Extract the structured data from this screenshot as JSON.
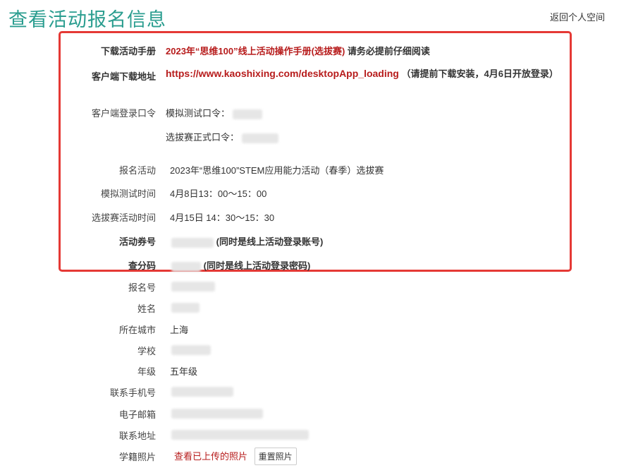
{
  "header": {
    "title": "查看活动报名信息",
    "back_link": "返回个人空间"
  },
  "manual": {
    "label": "下载活动手册",
    "link_text": "2023年“思维100”线上活动操作手册(选拔赛)",
    "note": "请务必提前仔细阅读"
  },
  "client": {
    "label": "客户端下载地址",
    "url": "https://www.kaoshixing.com/desktopApp_loading",
    "note": "（请提前下载安装，4月6日开放登录）"
  },
  "login_codes": {
    "label": "客户端登录口令",
    "mock_label": "模拟测试口令：",
    "final_label": "选拔赛正式口令："
  },
  "activity": {
    "label": "报名活动",
    "value": "2023年“思维100”STEM应用能力活动（春季）选拔赛"
  },
  "mock_time": {
    "label": "模拟测试时间",
    "value": "4月8日13：00～15：00"
  },
  "final_time": {
    "label": "选拔赛活动时间",
    "value": "4月15日 14：30～15：30"
  },
  "voucher": {
    "label": "活动券号",
    "note": "(同时是线上活动登录账号)"
  },
  "score_code": {
    "label": "查分码",
    "note": "(同时是线上活动登录密码)"
  },
  "reg_no": {
    "label": "报名号"
  },
  "name": {
    "label": "姓名"
  },
  "city": {
    "label": "所在城市",
    "value": "上海"
  },
  "school": {
    "label": "学校"
  },
  "grade": {
    "label": "年级",
    "value": "五年级"
  },
  "phone": {
    "label": "联系手机号"
  },
  "email": {
    "label": "电子邮箱"
  },
  "address": {
    "label": "联系地址"
  },
  "photo": {
    "label": "学籍照片",
    "view_link": "查看已上传的照片",
    "reset_button": "重置照片"
  }
}
